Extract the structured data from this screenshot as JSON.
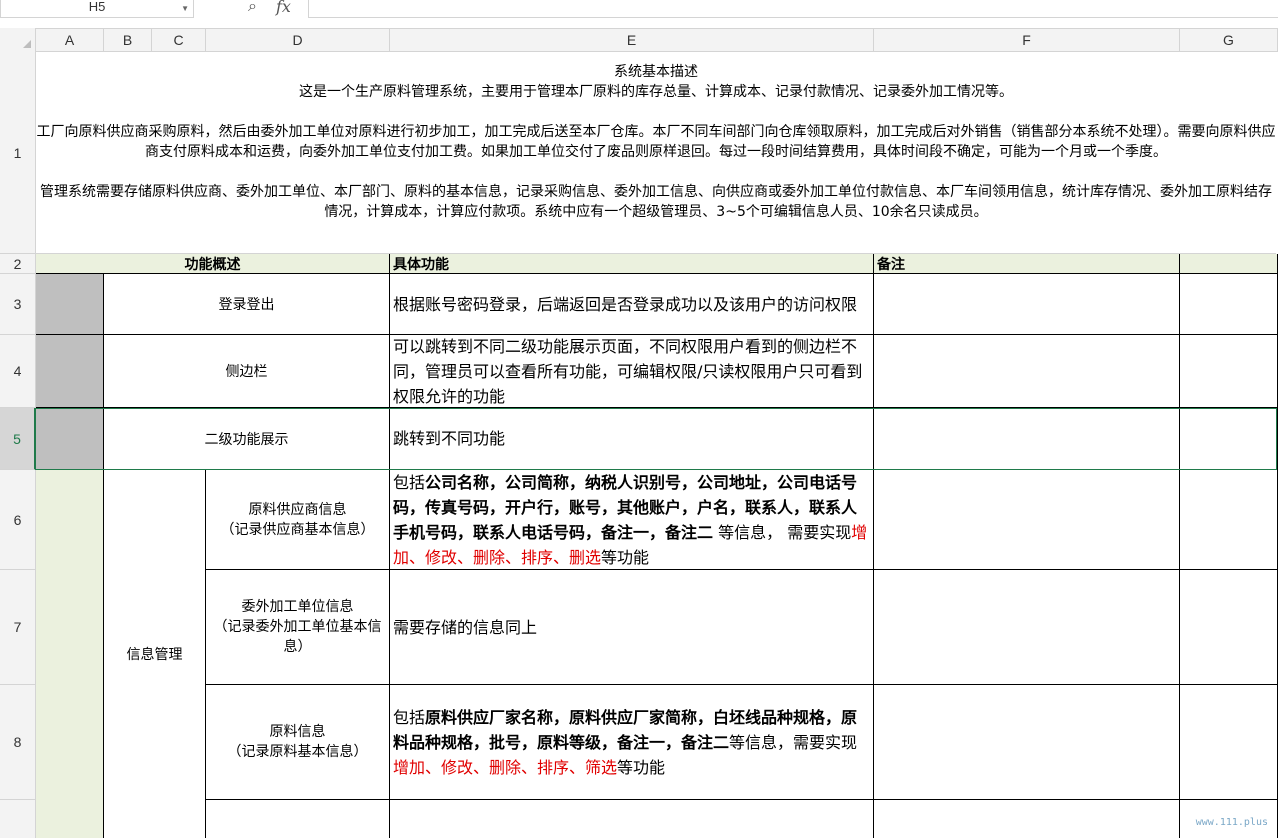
{
  "formula_bar": {
    "cell_ref": "H5",
    "zoom_icon": "zoom-icon",
    "fx_label": "fx"
  },
  "columns": [
    "A",
    "B",
    "C",
    "D",
    "E",
    "F",
    "G"
  ],
  "rows": [
    "1",
    "2",
    "3",
    "4",
    "5",
    "6",
    "7",
    "8"
  ],
  "description": {
    "title": "系统基本描述",
    "line1": "这是一个生产原料管理系统，主要用于管理本厂原料的库存总量、计算成本、记录付款情况、记录委外加工情况等。",
    "para2": "工厂向原料供应商采购原料，然后由委外加工单位对原料进行初步加工，加工完成后送至本厂仓库。本厂不同车间部门向仓库领取原料，加工完成后对外销售（销售部分本系统不处理）。需要向原料供应商支付原料成本和运费，向委外加工单位支付加工费。如果加工单位交付了废品则原样退回。每过一段时间结算费用，具体时间段不确定，可能为一个月或一个季度。",
    "para3": "管理系统需要存储原料供应商、委外加工单位、本厂部门、原料的基本信息，记录采购信息、委外加工信息、向供应商或委外加工单位付款信息、本厂车间领用信息，统计库存情况、委外加工原料结存情况，计算成本，计算应付款项。系统中应有一个超级管理员、3~5个可编辑信息人员、10余名只读成员。"
  },
  "header_row": {
    "func_overview": "功能概述",
    "detail": "具体功能",
    "note": "备注"
  },
  "row3": {
    "name": "登录登出",
    "detail": "根据账号密码登录，后端返回是否登录成功以及该用户的访问权限"
  },
  "row4": {
    "name": "侧边栏",
    "detail": "可以跳转到不同二级功能展示页面，不同权限用户看到的侧边栏不同，管理员可以查看所有功能，可编辑权限/只读权限用户只可看到权限允许的功能"
  },
  "row5": {
    "name": "二级功能展示",
    "detail": "跳转到不同功能"
  },
  "group": {
    "name": "信息管理"
  },
  "row6": {
    "name": "原料供应商信息",
    "sub": "（记录供应商基本信息）",
    "pre": "包括",
    "bold": "公司名称，公司简称，纳税人识别号，公司地址，公司电话号码，传真号码，开户行，账号，其他账户，户名，联系人，联系人手机号码，联系人电话号码，备注一，备注二",
    "mid": " 等信息， 需要实现",
    "ops": "增加、修改、删除、排序、删选",
    "post": "等功能"
  },
  "row7": {
    "name": "委外加工单位信息",
    "sub": "（记录委外加工单位基本信息）",
    "detail": "需要存储的信息同上"
  },
  "row8": {
    "name": "原料信息",
    "sub": "（记录原料基本信息）",
    "pre": "包括",
    "bold": "原料供应厂家名称，原料供应厂家简称，白坯线品种规格，原料品种规格，批号，原料等级，备注一，备注二",
    "mid": "等信息，需要实现",
    "ops": "增加、修改、删除、排序、筛选",
    "post": "等功能"
  },
  "watermark": "www.111.plus"
}
